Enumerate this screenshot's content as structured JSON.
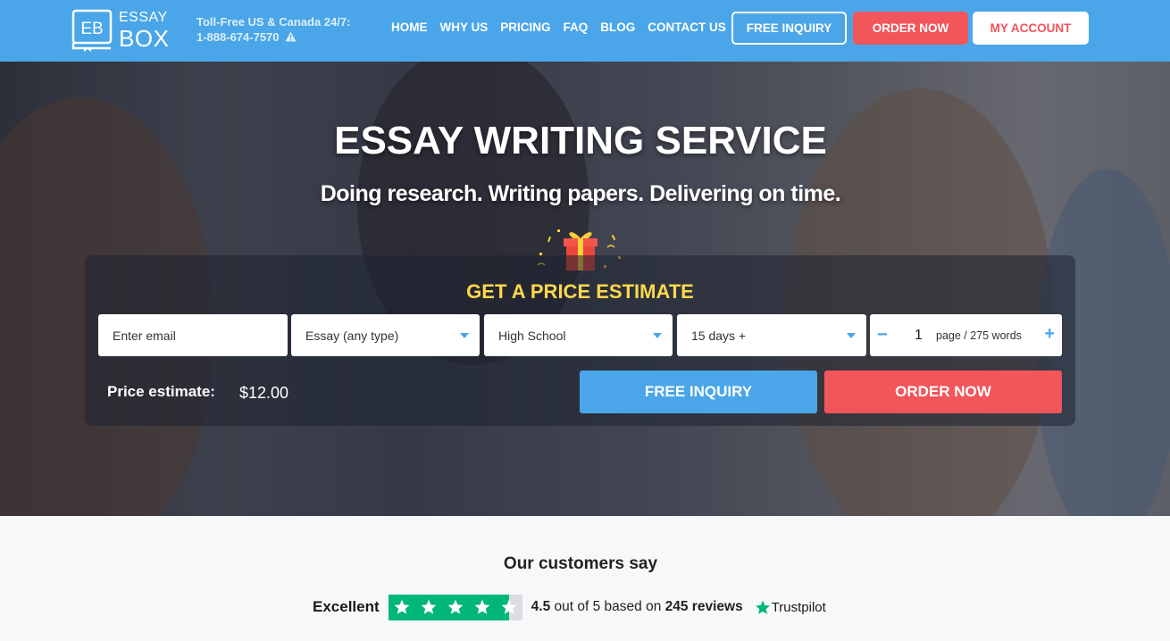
{
  "header": {
    "logo": {
      "line1": "ESSAY",
      "line2": "BOX",
      "mark": "EB"
    },
    "phone_label": "Toll-Free US & Canada 24/7:",
    "phone_number": "1-888-674-7570",
    "nav": [
      "HOME",
      "WHY US",
      "PRICING",
      "FAQ",
      "BLOG",
      "CONTACT US"
    ],
    "free_inquiry": "FREE INQUIRY",
    "order_now": "ORDER NOW",
    "my_account": "MY ACCOUNT"
  },
  "hero": {
    "title": "ESSAY WRITING SERVICE",
    "subtitle": "Doing research. Writing papers. Delivering on time."
  },
  "estimate": {
    "title": "GET A PRICE ESTIMATE",
    "email_placeholder": "Enter email",
    "paper_type": "Essay (any type)",
    "level": "High School",
    "deadline": "15 days +",
    "pages": "1",
    "pages_unit": "page / 275 words",
    "price_label": "Price estimate:",
    "price_value": "$12.00",
    "free_inquiry": "FREE INQUIRY",
    "order_now": "ORDER NOW"
  },
  "reviews": {
    "title": "Our customers say",
    "rating_word": "Excellent",
    "score": "4.5",
    "out_of": "out of 5 based on",
    "count": "245 reviews",
    "brand": "Trustpilot",
    "stars": 4.5
  },
  "colors": {
    "header_bg": "#4aa6e8",
    "accent_red": "#f2555a",
    "estimate_title": "#ffd84a",
    "trustpilot_green": "#00b67a"
  }
}
